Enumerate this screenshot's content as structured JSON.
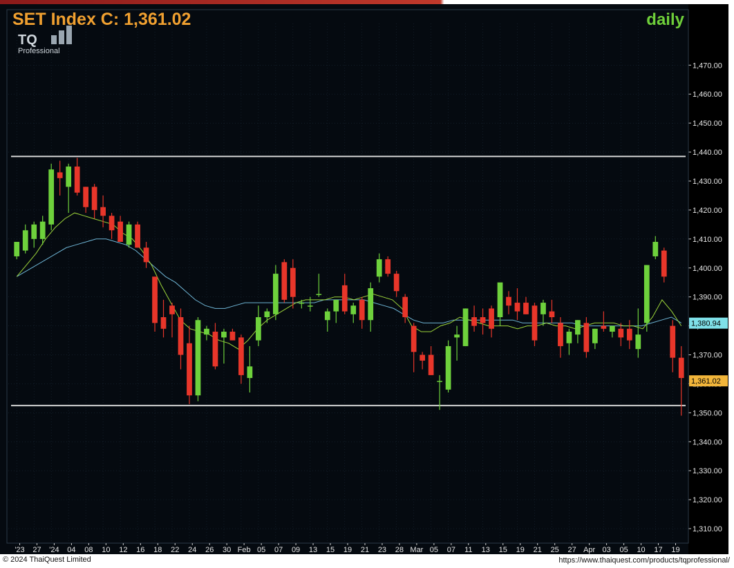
{
  "header": {
    "title": "SET Index C: 1,361.02",
    "period": "daily",
    "logo_main": "TQ",
    "logo_sub": "Professional"
  },
  "footer": {
    "copyright": "© 2024 ThaiQuest Limited",
    "url": "https://www.thaiquest.com/products/tqprofessional/"
  },
  "colors": {
    "background": "#050a10",
    "grid": "#1b2a38",
    "up": "#6ed13c",
    "down": "#e8362a",
    "title": "#f0a030",
    "period": "#6fcf3a",
    "ma_fast": "#9ed63a",
    "ma_slow": "#6fb6d6",
    "hline": "#d8d8d8",
    "axis_text": "#e6e6e6"
  },
  "chart_data": {
    "type": "candlestick",
    "ylim": [
      1305,
      1482
    ],
    "y_ticks": [
      "1,310.00",
      "1,320.00",
      "1,330.00",
      "1,340.00",
      "1,350.00",
      "1,360.00",
      "1,370.00",
      "1,380.00",
      "1,390.00",
      "1,400.00",
      "1,410.00",
      "1,420.00",
      "1,430.00",
      "1,440.00",
      "1,450.00",
      "1,460.00",
      "1,470.00"
    ],
    "y_tick_values": [
      1310,
      1320,
      1330,
      1340,
      1350,
      1360,
      1370,
      1380,
      1390,
      1400,
      1410,
      1420,
      1430,
      1440,
      1450,
      1460,
      1470
    ],
    "x_tick_labels": [
      "'23",
      "27",
      "'24",
      "04",
      "08",
      "10",
      "12",
      "16",
      "18",
      "22",
      "24",
      "26",
      "30",
      "Feb",
      "05",
      "07",
      "09",
      "13",
      "15",
      "19",
      "21",
      "23",
      "28",
      "Mar",
      "05",
      "07",
      "11",
      "13",
      "15",
      "19",
      "21",
      "25",
      "27",
      "Apr",
      "03",
      "05",
      "10",
      "17",
      "19"
    ],
    "horizontal_lines": [
      1438.5,
      1352.5
    ],
    "last_price_label": "1,361.02",
    "ma_label": "1,380.94",
    "candles": [
      {
        "o": 1404,
        "h": 1409,
        "l": 1403,
        "c": 1409
      },
      {
        "o": 1406,
        "h": 1415,
        "l": 1405,
        "c": 1413
      },
      {
        "o": 1410,
        "h": 1416,
        "l": 1407,
        "c": 1415
      },
      {
        "o": 1410,
        "h": 1418,
        "l": 1408,
        "c": 1416
      },
      {
        "o": 1415,
        "h": 1436,
        "l": 1413,
        "c": 1434
      },
      {
        "o": 1433,
        "h": 1437,
        "l": 1425,
        "c": 1431
      },
      {
        "o": 1428,
        "h": 1436,
        "l": 1419,
        "c": 1435
      },
      {
        "o": 1435,
        "h": 1438,
        "l": 1425,
        "c": 1426
      },
      {
        "o": 1428,
        "h": 1428,
        "l": 1419,
        "c": 1421
      },
      {
        "o": 1428,
        "h": 1429,
        "l": 1417,
        "c": 1420
      },
      {
        "o": 1421,
        "h": 1425,
        "l": 1414,
        "c": 1418
      },
      {
        "o": 1418,
        "h": 1419,
        "l": 1410,
        "c": 1413
      },
      {
        "o": 1416,
        "h": 1418,
        "l": 1410,
        "c": 1409
      },
      {
        "o": 1408,
        "h": 1416,
        "l": 1407,
        "c": 1415
      },
      {
        "o": 1415,
        "h": 1416,
        "l": 1407,
        "c": 1407
      },
      {
        "o": 1407,
        "h": 1409,
        "l": 1400,
        "c": 1402
      },
      {
        "o": 1397,
        "h": 1397,
        "l": 1378,
        "c": 1381
      },
      {
        "o": 1383,
        "h": 1389,
        "l": 1376,
        "c": 1379
      },
      {
        "o": 1387,
        "h": 1388,
        "l": 1376,
        "c": 1384
      },
      {
        "o": 1383,
        "h": 1386,
        "l": 1365,
        "c": 1370
      },
      {
        "o": 1374,
        "h": 1380,
        "l": 1353,
        "c": 1356
      },
      {
        "o": 1356,
        "h": 1383,
        "l": 1354,
        "c": 1382
      },
      {
        "o": 1377,
        "h": 1380,
        "l": 1375,
        "c": 1379
      },
      {
        "o": 1378,
        "h": 1381,
        "l": 1365,
        "c": 1366
      },
      {
        "o": 1376,
        "h": 1379,
        "l": 1367,
        "c": 1378
      },
      {
        "o": 1378,
        "h": 1379,
        "l": 1375,
        "c": 1375
      },
      {
        "o": 1376,
        "h": 1377,
        "l": 1360,
        "c": 1363
      },
      {
        "o": 1362,
        "h": 1373,
        "l": 1357,
        "c": 1366
      },
      {
        "o": 1375,
        "h": 1387,
        "l": 1373,
        "c": 1383
      },
      {
        "o": 1383,
        "h": 1386,
        "l": 1381,
        "c": 1385
      },
      {
        "o": 1384,
        "h": 1401,
        "l": 1382,
        "c": 1398
      },
      {
        "o": 1402,
        "h": 1403,
        "l": 1388,
        "c": 1389
      },
      {
        "o": 1400,
        "h": 1403,
        "l": 1386,
        "c": 1390
      },
      {
        "o": 1388,
        "h": 1389,
        "l": 1386,
        "c": 1388
      },
      {
        "o": 1387,
        "h": 1390,
        "l": 1385,
        "c": 1387
      },
      {
        "o": 1391,
        "h": 1398,
        "l": 1390,
        "c": 1391
      },
      {
        "o": 1382,
        "h": 1386,
        "l": 1378,
        "c": 1385
      },
      {
        "o": 1385,
        "h": 1388,
        "l": 1381,
        "c": 1389
      },
      {
        "o": 1394,
        "h": 1398,
        "l": 1384,
        "c": 1385
      },
      {
        "o": 1384,
        "h": 1388,
        "l": 1381,
        "c": 1387
      },
      {
        "o": 1389,
        "h": 1390,
        "l": 1379,
        "c": 1382
      },
      {
        "o": 1382,
        "h": 1395,
        "l": 1378,
        "c": 1393
      },
      {
        "o": 1397,
        "h": 1405,
        "l": 1395,
        "c": 1403
      },
      {
        "o": 1403,
        "h": 1404,
        "l": 1397,
        "c": 1398
      },
      {
        "o": 1398,
        "h": 1399,
        "l": 1390,
        "c": 1392
      },
      {
        "o": 1390,
        "h": 1391,
        "l": 1381,
        "c": 1383
      },
      {
        "o": 1380,
        "h": 1381,
        "l": 1364,
        "c": 1371
      },
      {
        "o": 1370,
        "h": 1371,
        "l": 1365,
        "c": 1368
      },
      {
        "o": 1370,
        "h": 1373,
        "l": 1363,
        "c": 1363
      },
      {
        "o": 1361,
        "h": 1363,
        "l": 1351,
        "c": 1361
      },
      {
        "o": 1358,
        "h": 1375,
        "l": 1357,
        "c": 1373
      },
      {
        "o": 1376,
        "h": 1380,
        "l": 1368,
        "c": 1377
      },
      {
        "o": 1373,
        "h": 1386,
        "l": 1373,
        "c": 1386
      },
      {
        "o": 1383,
        "h": 1387,
        "l": 1378,
        "c": 1380
      },
      {
        "o": 1383,
        "h": 1386,
        "l": 1377,
        "c": 1381
      },
      {
        "o": 1386,
        "h": 1387,
        "l": 1376,
        "c": 1379
      },
      {
        "o": 1383,
        "h": 1391,
        "l": 1380,
        "c": 1395
      },
      {
        "o": 1390,
        "h": 1392,
        "l": 1384,
        "c": 1387
      },
      {
        "o": 1388,
        "h": 1393,
        "l": 1382,
        "c": 1385
      },
      {
        "o": 1388,
        "h": 1390,
        "l": 1384,
        "c": 1384
      },
      {
        "o": 1387,
        "h": 1388,
        "l": 1373,
        "c": 1375
      },
      {
        "o": 1384,
        "h": 1389,
        "l": 1380,
        "c": 1388
      },
      {
        "o": 1385,
        "h": 1389,
        "l": 1381,
        "c": 1383
      },
      {
        "o": 1381,
        "h": 1383,
        "l": 1369,
        "c": 1373
      },
      {
        "o": 1374,
        "h": 1379,
        "l": 1370,
        "c": 1378
      },
      {
        "o": 1377,
        "h": 1382,
        "l": 1374,
        "c": 1382
      },
      {
        "o": 1381,
        "h": 1383,
        "l": 1369,
        "c": 1371
      },
      {
        "o": 1374,
        "h": 1379,
        "l": 1372,
        "c": 1379
      },
      {
        "o": 1380,
        "h": 1385,
        "l": 1378,
        "c": 1379
      },
      {
        "o": 1378,
        "h": 1380,
        "l": 1376,
        "c": 1380
      },
      {
        "o": 1379,
        "h": 1381,
        "l": 1373,
        "c": 1376
      },
      {
        "o": 1379,
        "h": 1382,
        "l": 1372,
        "c": 1375
      },
      {
        "o": 1372,
        "h": 1386,
        "l": 1369,
        "c": 1377
      },
      {
        "o": 1381,
        "h": 1401,
        "l": 1378,
        "c": 1401
      },
      {
        "o": 1404,
        "h": 1411,
        "l": 1403,
        "c": 1409
      },
      {
        "o": 1406,
        "h": 1407,
        "l": 1395,
        "c": 1397
      },
      {
        "o": 1380,
        "h": 1382,
        "l": 1364,
        "c": 1369
      },
      {
        "o": 1369,
        "h": 1373,
        "l": 1349,
        "c": 1362
      }
    ],
    "ma_fast": [
      1397,
      1401,
      1405,
      1410,
      1414,
      1417,
      1419,
      1418,
      1417,
      1416,
      1415,
      1412,
      1410,
      1406,
      1401,
      1394,
      1388,
      1382,
      1379,
      1378,
      1377,
      1375,
      1374,
      1372,
      1375,
      1379,
      1382,
      1384,
      1386,
      1388,
      1389,
      1389,
      1389,
      1390,
      1390,
      1389,
      1390,
      1391,
      1390,
      1389,
      1386,
      1380,
      1378,
      1378,
      1380,
      1381,
      1383,
      1382,
      1381,
      1380,
      1380,
      1380,
      1379,
      1380,
      1380,
      1381,
      1380,
      1380,
      1379,
      1380,
      1381,
      1381,
      1381,
      1380,
      1380,
      1379,
      1383,
      1389,
      1385,
      1380
    ],
    "ma_slow": [
      1397,
      1399,
      1401,
      1403,
      1405,
      1407,
      1408,
      1409,
      1410,
      1410,
      1409,
      1408,
      1406,
      1403,
      1400,
      1397,
      1395,
      1392,
      1389,
      1387,
      1386,
      1386,
      1387,
      1388,
      1388,
      1388,
      1388,
      1388,
      1388,
      1388,
      1388,
      1389,
      1389,
      1389,
      1389,
      1389,
      1388,
      1387,
      1386,
      1384,
      1382,
      1381,
      1381,
      1381,
      1382,
      1382,
      1382,
      1382,
      1382,
      1382,
      1382,
      1381,
      1381,
      1381,
      1381,
      1381,
      1381,
      1380,
      1380,
      1380,
      1380,
      1380,
      1380,
      1380,
      1381,
      1382,
      1383,
      1381
    ]
  }
}
